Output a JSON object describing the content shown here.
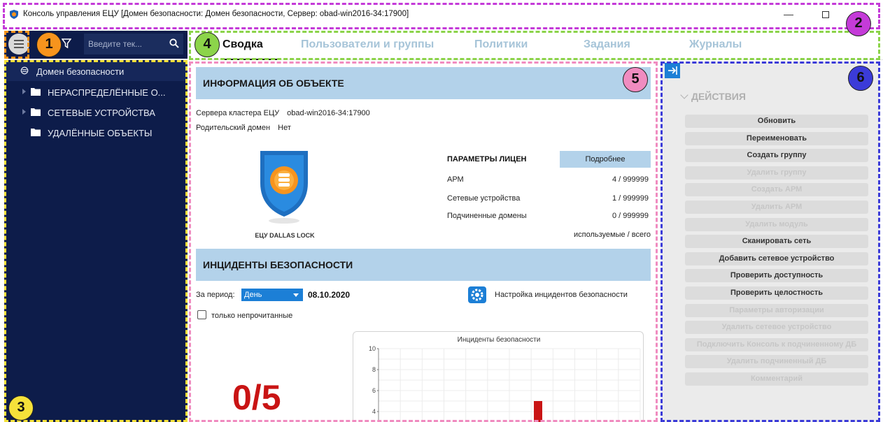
{
  "window": {
    "title": "Консоль управления ЕЦУ [Домен безопасности: Домен безопасности, Сервер: obad-win2016-34:17900]",
    "minimize_glyph": "—"
  },
  "sidebar": {
    "search_placeholder": "Введите тек...",
    "tree": [
      {
        "label": "Домен безопасности",
        "icon": "domain-icon"
      },
      {
        "label": "НЕРАСПРЕДЕЛЁННЫЕ О...",
        "icon": "folder-icon"
      },
      {
        "label": "СЕТЕВЫЕ УСТРОЙСТВА",
        "icon": "folder-icon"
      },
      {
        "label": "УДАЛЁННЫЕ ОБЪЕКТЫ",
        "icon": "folder-icon"
      }
    ]
  },
  "tabs": [
    {
      "label": "Сводка",
      "active": true
    },
    {
      "label": "Пользователи и группы",
      "active": false
    },
    {
      "label": "Политики",
      "active": false
    },
    {
      "label": "Задания",
      "active": false
    },
    {
      "label": "Журналы",
      "active": false
    }
  ],
  "object_info": {
    "title": "ИНФОРМАЦИЯ ОБ ОБЪЕКТЕ",
    "cluster_label": "Сервера кластера ЕЦУ",
    "cluster_value": "obad-win2016-34:17900",
    "parent_label": "Родительский домен",
    "parent_value": "Нет",
    "logo_caption": "ЕЦУ DALLAS LOCK",
    "license": {
      "title": "ПАРАМЕТРЫ ЛИЦЕН",
      "more_button": "Подробнее",
      "rows": [
        {
          "label": "АРМ",
          "value": "4 / 999999"
        },
        {
          "label": "Сетевые устройства",
          "value": "1 / 999999"
        },
        {
          "label": "Подчиненные домены",
          "value": "0 / 999999"
        }
      ],
      "legend": "используемые / всего"
    }
  },
  "incidents": {
    "title": "ИНЦИДЕНТЫ БЕЗОПАСНОСТИ",
    "period_label": "За период:",
    "period_value": "День",
    "date": "08.10.2020",
    "settings_label": "Настройка инцидентов безопасности",
    "unread_label": "только непрочитанные",
    "unread_checked": false,
    "counter": "0/5"
  },
  "chart_data": {
    "type": "bar",
    "title": "Инциденты безопасности",
    "xlabel": "",
    "ylabel": "",
    "y_ticks": [
      4,
      6,
      8,
      10
    ],
    "ylim": [
      0,
      10
    ],
    "grid": true,
    "bars": [
      {
        "value": 5,
        "color": "#c91414"
      }
    ]
  },
  "actions": {
    "header": "ДЕЙСТВИЯ",
    "buttons": [
      {
        "label": "Обновить",
        "enabled": true
      },
      {
        "label": "Переименовать",
        "enabled": true
      },
      {
        "label": "Создать группу",
        "enabled": true
      },
      {
        "label": "Удалить группу",
        "enabled": false
      },
      {
        "label": "Создать АРМ",
        "enabled": false
      },
      {
        "label": "Удалить АРМ",
        "enabled": false
      },
      {
        "label": "Удалить модуль",
        "enabled": false
      },
      {
        "label": "Сканировать сеть",
        "enabled": true
      },
      {
        "label": "Добавить сетевое устройство",
        "enabled": true
      },
      {
        "label": "Проверить доступность",
        "enabled": true
      },
      {
        "label": "Проверить целостность",
        "enabled": true
      },
      {
        "label": "Параметры авторизации",
        "enabled": false
      },
      {
        "label": "Удалить сетевое устройство",
        "enabled": false
      },
      {
        "label": "Подключить Консоль к подчиненному ДБ",
        "enabled": false
      },
      {
        "label": "Удалить подчиненный ДБ",
        "enabled": false
      },
      {
        "label": "Комментарий",
        "enabled": false
      }
    ]
  },
  "callouts": [
    {
      "number": "1",
      "color": "#f7941d"
    },
    {
      "number": "2",
      "color": "#c43bd8"
    },
    {
      "number": "3",
      "color": "#f5e13a"
    },
    {
      "number": "4",
      "color": "#8cd44a"
    },
    {
      "number": "5",
      "color": "#f08cc0"
    },
    {
      "number": "6",
      "color": "#3b3bd8"
    }
  ],
  "colors": {
    "sidebar_bg": "#0d1c4a",
    "accent_blue": "#1c7fd6",
    "section_header": "#b3d2ea",
    "counter_red": "#c91414",
    "tab_inactive": "#a6c4d8"
  }
}
